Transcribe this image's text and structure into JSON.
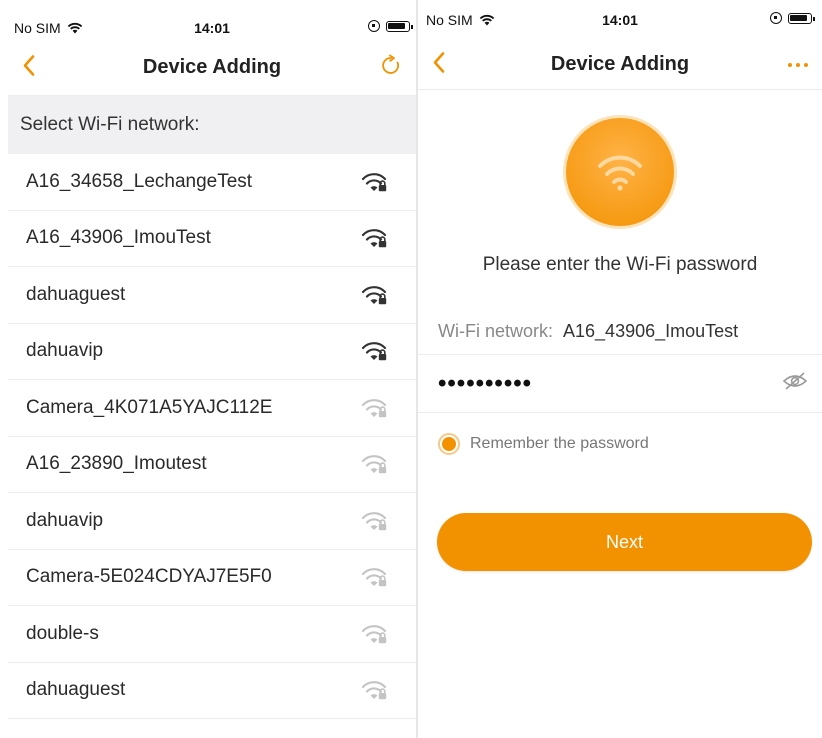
{
  "colors": {
    "accent": "#f39200",
    "signal_strong": "#333333",
    "signal_weak": "#c4c4c4"
  },
  "left": {
    "status": {
      "carrier": "No SIM",
      "time": "14:01"
    },
    "nav": {
      "title": "Device Adding",
      "back_icon": "chevron-left-icon",
      "action_icon": "refresh-icon"
    },
    "section_header": "Select Wi-Fi network:",
    "networks": [
      {
        "name": "A16_34658_LechangeTest",
        "signal": "strong",
        "locked": true
      },
      {
        "name": "A16_43906_ImouTest",
        "signal": "strong",
        "locked": true
      },
      {
        "name": "dahuaguest",
        "signal": "strong",
        "locked": true
      },
      {
        "name": "dahuavip",
        "signal": "strong",
        "locked": true
      },
      {
        "name": "Camera_4K071A5YAJC112E",
        "signal": "weak",
        "locked": true
      },
      {
        "name": "A16_23890_Imoutest",
        "signal": "weak",
        "locked": true
      },
      {
        "name": "dahuavip",
        "signal": "weak",
        "locked": true
      },
      {
        "name": "Camera-5E024CDYAJ7E5F0",
        "signal": "weak",
        "locked": true
      },
      {
        "name": "double-s",
        "signal": "weak",
        "locked": true
      },
      {
        "name": "dahuaguest",
        "signal": "weak",
        "locked": true
      }
    ]
  },
  "right": {
    "status": {
      "carrier": "No SIM",
      "time": "14:01"
    },
    "nav": {
      "title": "Device Adding",
      "back_icon": "chevron-left-icon",
      "action_icon": "more-dots-icon"
    },
    "prompt": "Please enter the Wi-Fi password",
    "network_label": "Wi-Fi network:",
    "network_value": "A16_43906_ImouTest",
    "password_masked": "••••••••••",
    "remember_label": "Remember the password",
    "remember_checked": true,
    "next_label": "Next"
  }
}
